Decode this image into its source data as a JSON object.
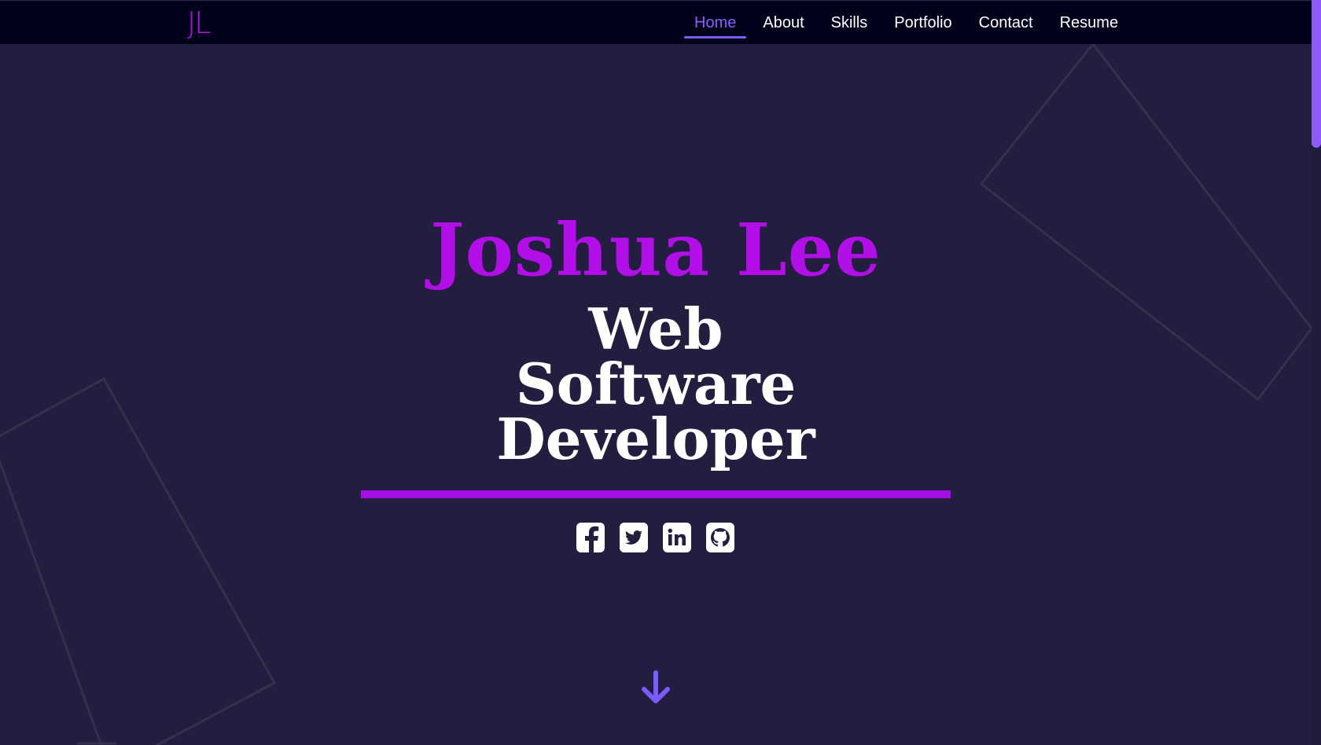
{
  "logo": {
    "text": "JL"
  },
  "nav": {
    "items": [
      {
        "label": "Home",
        "active": true
      },
      {
        "label": "About",
        "active": false
      },
      {
        "label": "Skills",
        "active": false
      },
      {
        "label": "Portfolio",
        "active": false
      },
      {
        "label": "Contact",
        "active": false
      },
      {
        "label": "Resume",
        "active": false
      }
    ]
  },
  "hero": {
    "name": "Joshua Lee",
    "role_lines": [
      "Web",
      "Software",
      "Developer"
    ]
  },
  "socials": [
    {
      "icon": "facebook-icon"
    },
    {
      "icon": "twitter-icon"
    },
    {
      "icon": "linkedin-icon"
    },
    {
      "icon": "github-icon"
    }
  ],
  "scroll_down": {
    "icon": "arrow-down-icon"
  },
  "colors": {
    "background": "#231d3f",
    "navbar": "#03021b",
    "accent_purple": "#b10ee8",
    "nav_active": "#8a5cff",
    "scrollbar_thumb": "#8b5cf6"
  }
}
